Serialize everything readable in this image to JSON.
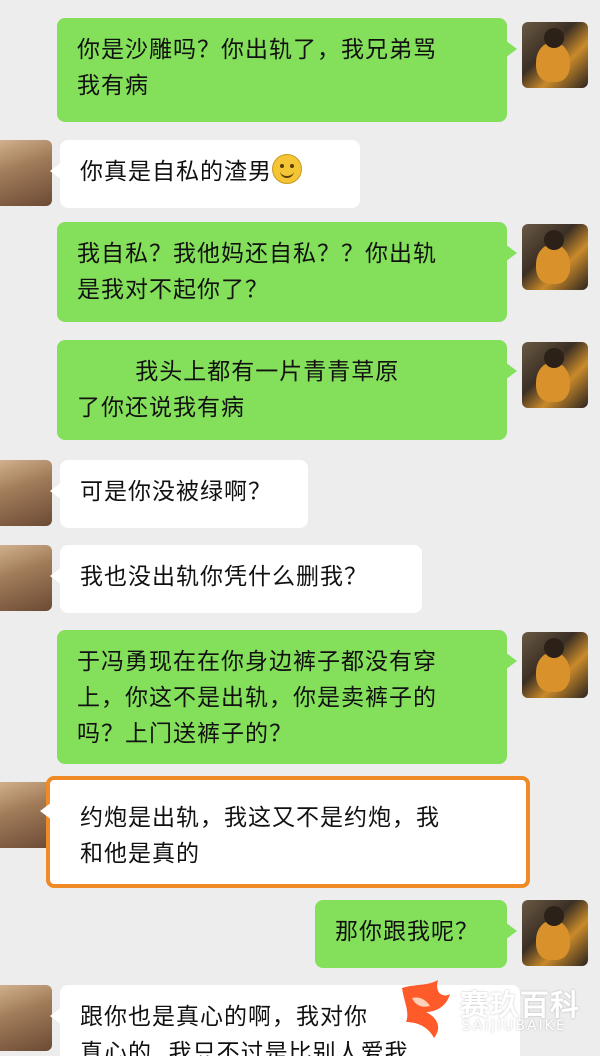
{
  "messages": [
    {
      "sender": "me",
      "text": "你是沙雕吗？你出轨了，我兄弟骂\n我有病"
    },
    {
      "sender": "her",
      "text": "你真是自私的渣男",
      "emoji": "smiley-icon"
    },
    {
      "sender": "me",
      "text": "我自私？我他妈还自私？？你出轨\n是我对不起你了？"
    },
    {
      "sender": "me",
      "text": "       我头上都有一片青青草原\n了你还说我有病"
    },
    {
      "sender": "her",
      "text": "可是你没被绿啊？"
    },
    {
      "sender": "her",
      "text": "我也没出轨你凭什么删我？"
    },
    {
      "sender": "me",
      "text": "于冯勇现在在你身边裤子都没有穿\n上，你这不是出轨，你是卖裤子的\n吗？上门送裤子的？"
    },
    {
      "sender": "her",
      "text": "约炮是出轨，我这又不是约炮，我\n和他是真的",
      "highlighted": true,
      "highlight_color": "#f08a24"
    },
    {
      "sender": "me",
      "text": "那你跟我呢？"
    },
    {
      "sender": "her",
      "text": "跟你也是真心的啊，我对你\n真心的  我只不过是比别人爱我"
    }
  ],
  "colors": {
    "me_bubble": "#84e05a",
    "her_bubble": "#ffffff",
    "background": "#ededed"
  },
  "watermark": {
    "cn": "赛玖百科",
    "en": "SAIJIUBAIKE"
  }
}
